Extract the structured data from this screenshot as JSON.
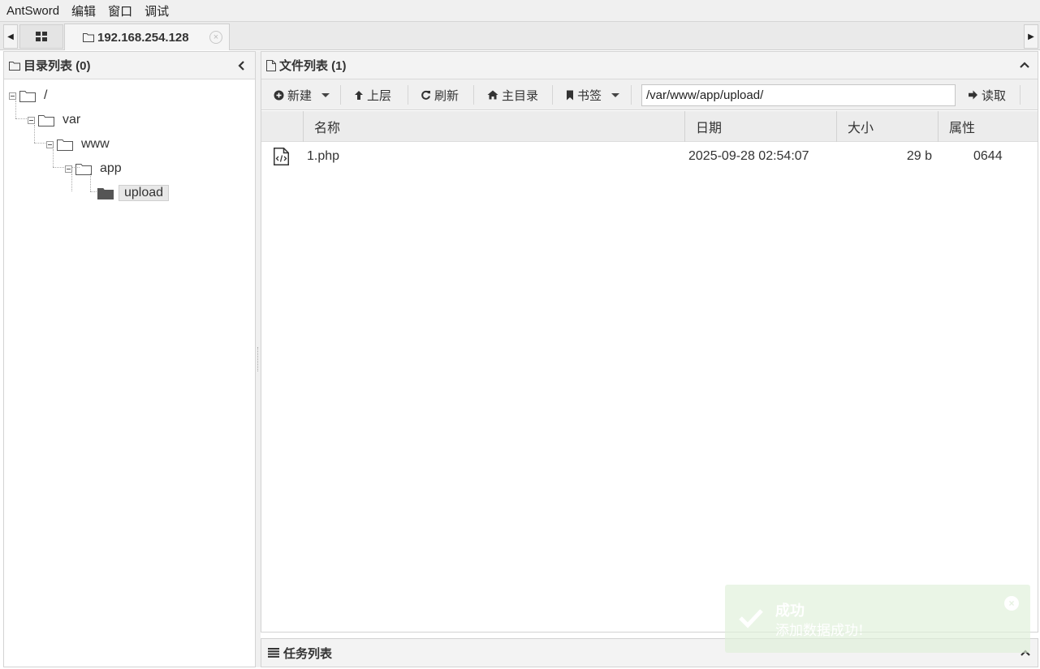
{
  "menu": {
    "items": [
      "AntSword",
      "编辑",
      "窗口",
      "调试"
    ]
  },
  "tabs": {
    "active_label": "192.168.254.128",
    "close_glyph": "×"
  },
  "left_panel": {
    "title": "目录列表 (0)",
    "tree": {
      "root": "/",
      "var": "var",
      "www": "www",
      "app": "app",
      "upload": "upload"
    }
  },
  "right_panel": {
    "title": "文件列表 (1)",
    "toolbar": {
      "new_label": "新建",
      "up_label": "上层",
      "refresh_label": "刷新",
      "home_label": "主目录",
      "bookmark_label": "书签",
      "path_value": "/var/www/app/upload/",
      "read_label": "读取"
    },
    "columns": {
      "name": "名称",
      "date": "日期",
      "size": "大小",
      "perm": "属性"
    },
    "rows": [
      {
        "name": "1.php",
        "date": "2025-09-28 02:54:07",
        "size": "29 b",
        "perm": "0644",
        "icon": "php-file-icon"
      }
    ]
  },
  "task_panel": {
    "title": "任务列表"
  },
  "toast": {
    "title": "成功",
    "message": "添加数据成功!",
    "close_glyph": "×"
  },
  "colors": {
    "toast_bg": "#dff0d8",
    "header_bg": "#f3f3f3",
    "tabbar_bg": "#eaeaea"
  }
}
